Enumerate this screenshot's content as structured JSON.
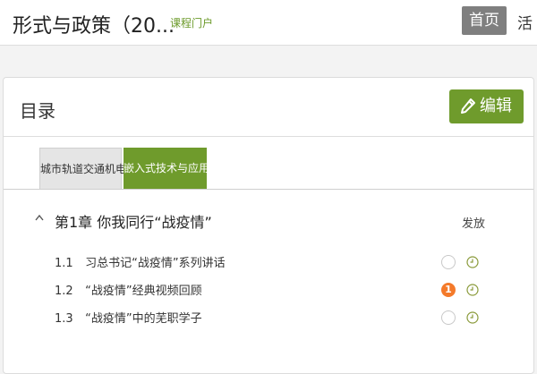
{
  "header": {
    "course_title": "形式与政策（20...",
    "portal_link": "课程门户",
    "nav": {
      "home": "首页",
      "activity": "活"
    }
  },
  "panel": {
    "title": "目录",
    "edit_label": "编辑",
    "tabs": [
      {
        "label": "城市轨道交通机电"
      },
      {
        "label": "嵌入式技术与应用"
      }
    ],
    "publish_header": "发放"
  },
  "chapter": {
    "title": "第1章 你我同行“战疫情”",
    "lessons": [
      {
        "num": "1.1",
        "title": "习总书记“战疫情”系列讲话",
        "badge": ""
      },
      {
        "num": "1.2",
        "title": "“战疫情”经典视频回顾",
        "badge": "1"
      },
      {
        "num": "1.3",
        "title": "“战疫情”中的芜职学子",
        "badge": ""
      }
    ]
  },
  "colors": {
    "accent": "#6f9b2c",
    "badge": "#f47a2a",
    "tab_home": "#7f7f7f"
  }
}
